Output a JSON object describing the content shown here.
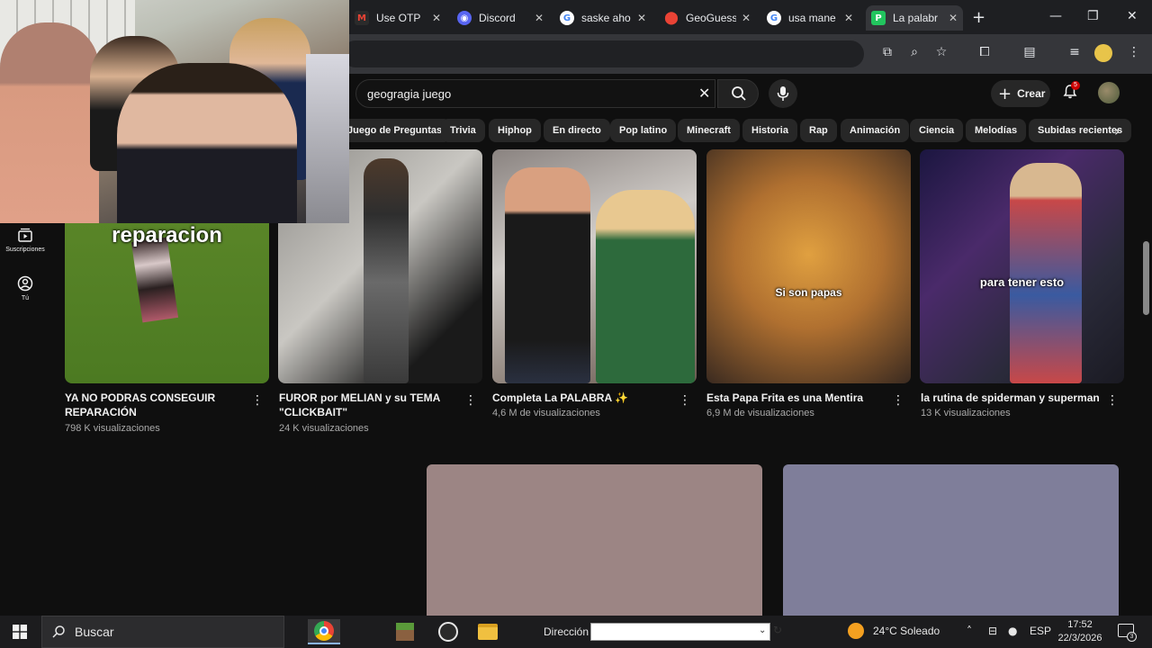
{
  "browser": {
    "tabs": [
      {
        "title": "Use OTP",
        "icon": "gmail-icon",
        "color": "#ea4335",
        "glyph": "M"
      },
      {
        "title": "Discord",
        "icon": "discord-icon",
        "color": "#5865f2",
        "glyph": "◉"
      },
      {
        "title": "saske aho",
        "icon": "google-icon",
        "color": "#ffffff",
        "glyph": "G"
      },
      {
        "title": "GeoGuess",
        "icon": "map-pin-icon",
        "color": "#ea4335",
        "glyph": "⬤"
      },
      {
        "title": "usa mane",
        "icon": "google-icon",
        "color": "#ffffff",
        "glyph": "G"
      },
      {
        "title": "La palabr",
        "icon": "p-app-icon",
        "color": "#22c55e",
        "glyph": "P"
      }
    ],
    "new_tab": "+",
    "win_min": "—",
    "win_max": "❐",
    "win_close": "✕"
  },
  "youtube": {
    "search_value": "geogragia juego",
    "create_label": "Crear",
    "notifications_count": "5",
    "chips": [
      "Juego de Preguntas",
      "Trivia",
      "Hiphop",
      "En directo",
      "Pop latino",
      "Minecraft",
      "Historia",
      "Rap",
      "Animación",
      "Ciencia",
      "Melodías",
      "Subidas recientes"
    ],
    "sidebar": [
      {
        "label": "Suscripciones",
        "icon": "subscriptions-icon"
      },
      {
        "label": "Tú",
        "icon": "you-icon"
      }
    ],
    "shorts": [
      {
        "title": "YA NO PODRAS CONSEGUIR REPARACIÓN",
        "views": "798 K visualizaciones",
        "caption": "reparacion"
      },
      {
        "title": "FUROR por MELIAN y su TEMA \"CLICKBAIT\"",
        "views": "24 K visualizaciones",
        "caption": ""
      },
      {
        "title": "Completa La PALABRA ✨",
        "views": "4,6 M de visualizaciones",
        "caption": ""
      },
      {
        "title": "Esta Papa Frita es una Mentira",
        "views": "6,9 M de visualizaciones",
        "caption": "Si son papas"
      },
      {
        "title": "la rutina de spiderman y superman",
        "views": "13 K visualizaciones",
        "caption": "para tener esto"
      }
    ],
    "placeholder_colors": [
      "#9c8584",
      "#7f7e9a"
    ]
  },
  "taskbar": {
    "search_placeholder": "Buscar",
    "address_label": "Dirección",
    "weather": "24°C  Soleado",
    "language": "ESP",
    "time": "17:52",
    "date": "22/3/2026",
    "notification_count": "3"
  }
}
